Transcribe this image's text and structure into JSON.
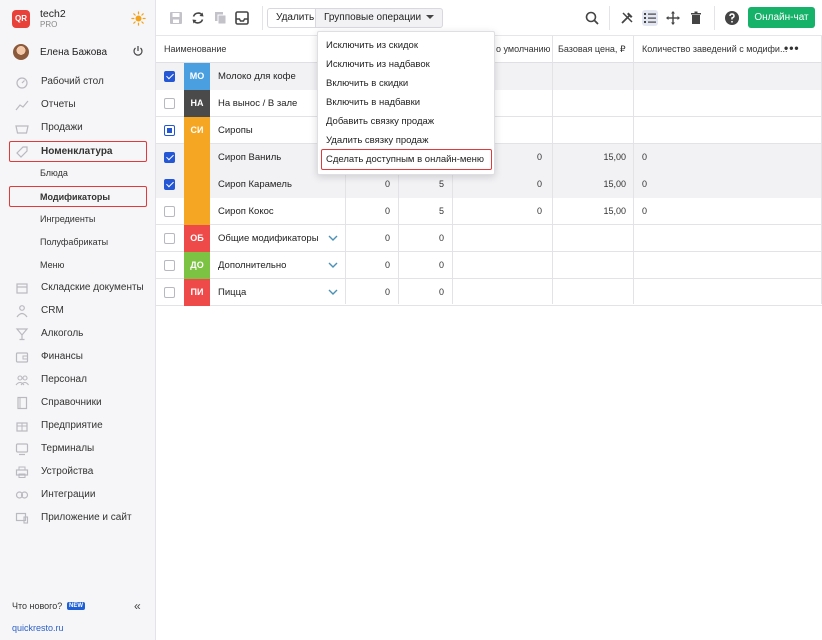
{
  "brand": {
    "logo_text": "QR",
    "name": "tech2",
    "plan": "PRO"
  },
  "user": {
    "name": "Елена Бажова"
  },
  "nav": {
    "desktop": "Рабочий стол",
    "reports": "Отчеты",
    "sales": "Продажи",
    "nomenclature": "Номенклатура",
    "dishes": "Блюда",
    "modifiers": "Модификаторы",
    "ingredients": "Ингредиенты",
    "semi": "Полуфабрикаты",
    "menu": "Меню",
    "warehouse": "Складские документы",
    "crm": "CRM",
    "alcohol": "Алкоголь",
    "finance": "Финансы",
    "staff": "Персонал",
    "refs": "Справочники",
    "enterprise": "Предприятие",
    "terminals": "Терминалы",
    "devices": "Устройства",
    "integrations": "Интеграции",
    "app_site": "Приложение и сайт"
  },
  "footer": {
    "whats_new": "Что нового?",
    "new_badge": "NEW",
    "site": "quickresto.ru"
  },
  "toolbar": {
    "delete_label": "Удалить",
    "group_ops_label": "Групповые операции",
    "chat_label": "Онлайн-чат"
  },
  "table": {
    "headers": {
      "name": "Наименование",
      "default": "о умолчанию",
      "base_price": "Базовая цена, ₽",
      "venues": "Количество заведений с модифи..."
    },
    "rows": [
      {
        "tag": "МО",
        "name": "Молоко для кофе",
        "c1": "",
        "c2": "",
        "c3": "",
        "price": "",
        "venues": ""
      },
      {
        "tag": "НА",
        "name": "На вынос / В зале",
        "c1": "",
        "c2": "",
        "c3": "",
        "price": "",
        "venues": ""
      },
      {
        "tag": "СИ",
        "name": "Сиропы",
        "c1": "",
        "c2": "",
        "c3": "",
        "price": "",
        "venues": ""
      },
      {
        "tag": "",
        "name": "Сироп Ваниль",
        "c1": "",
        "c2": "",
        "c3": "0",
        "price": "15,00",
        "venues": "0"
      },
      {
        "tag": "",
        "name": "Сироп Карамель",
        "c1": "0",
        "c2": "5",
        "c3": "0",
        "price": "15,00",
        "venues": "0"
      },
      {
        "tag": "",
        "name": "Сироп Кокос",
        "c1": "0",
        "c2": "5",
        "c3": "0",
        "price": "15,00",
        "venues": "0"
      },
      {
        "tag": "ОБ",
        "name": "Общие модификаторы",
        "c1": "0",
        "c2": "0",
        "c3": "",
        "price": "",
        "venues": ""
      },
      {
        "tag": "ДО",
        "name": "Дополнительно",
        "c1": "0",
        "c2": "0",
        "c3": "",
        "price": "",
        "venues": ""
      },
      {
        "tag": "ПИ",
        "name": "Пицца",
        "c1": "0",
        "c2": "0",
        "c3": "",
        "price": "",
        "venues": ""
      }
    ]
  },
  "dropdown": {
    "items": [
      "Исключить из скидок",
      "Исключить из надбавок",
      "Включить в скидки",
      "Включить в надбавки",
      "Добавить связку продаж",
      "Удалить связку продаж",
      "Сделать доступным в онлайн-меню"
    ]
  },
  "colors": {
    "tag_mo": "#4a9fe0",
    "tag_na": "#4a4a4a",
    "tag_si": "#f5a623",
    "tag_ob": "#ef4a4a",
    "tag_do": "#7cc243",
    "tag_pi": "#ef4a4a",
    "accent": "#17b26a",
    "highlight": "#e03a3a"
  }
}
